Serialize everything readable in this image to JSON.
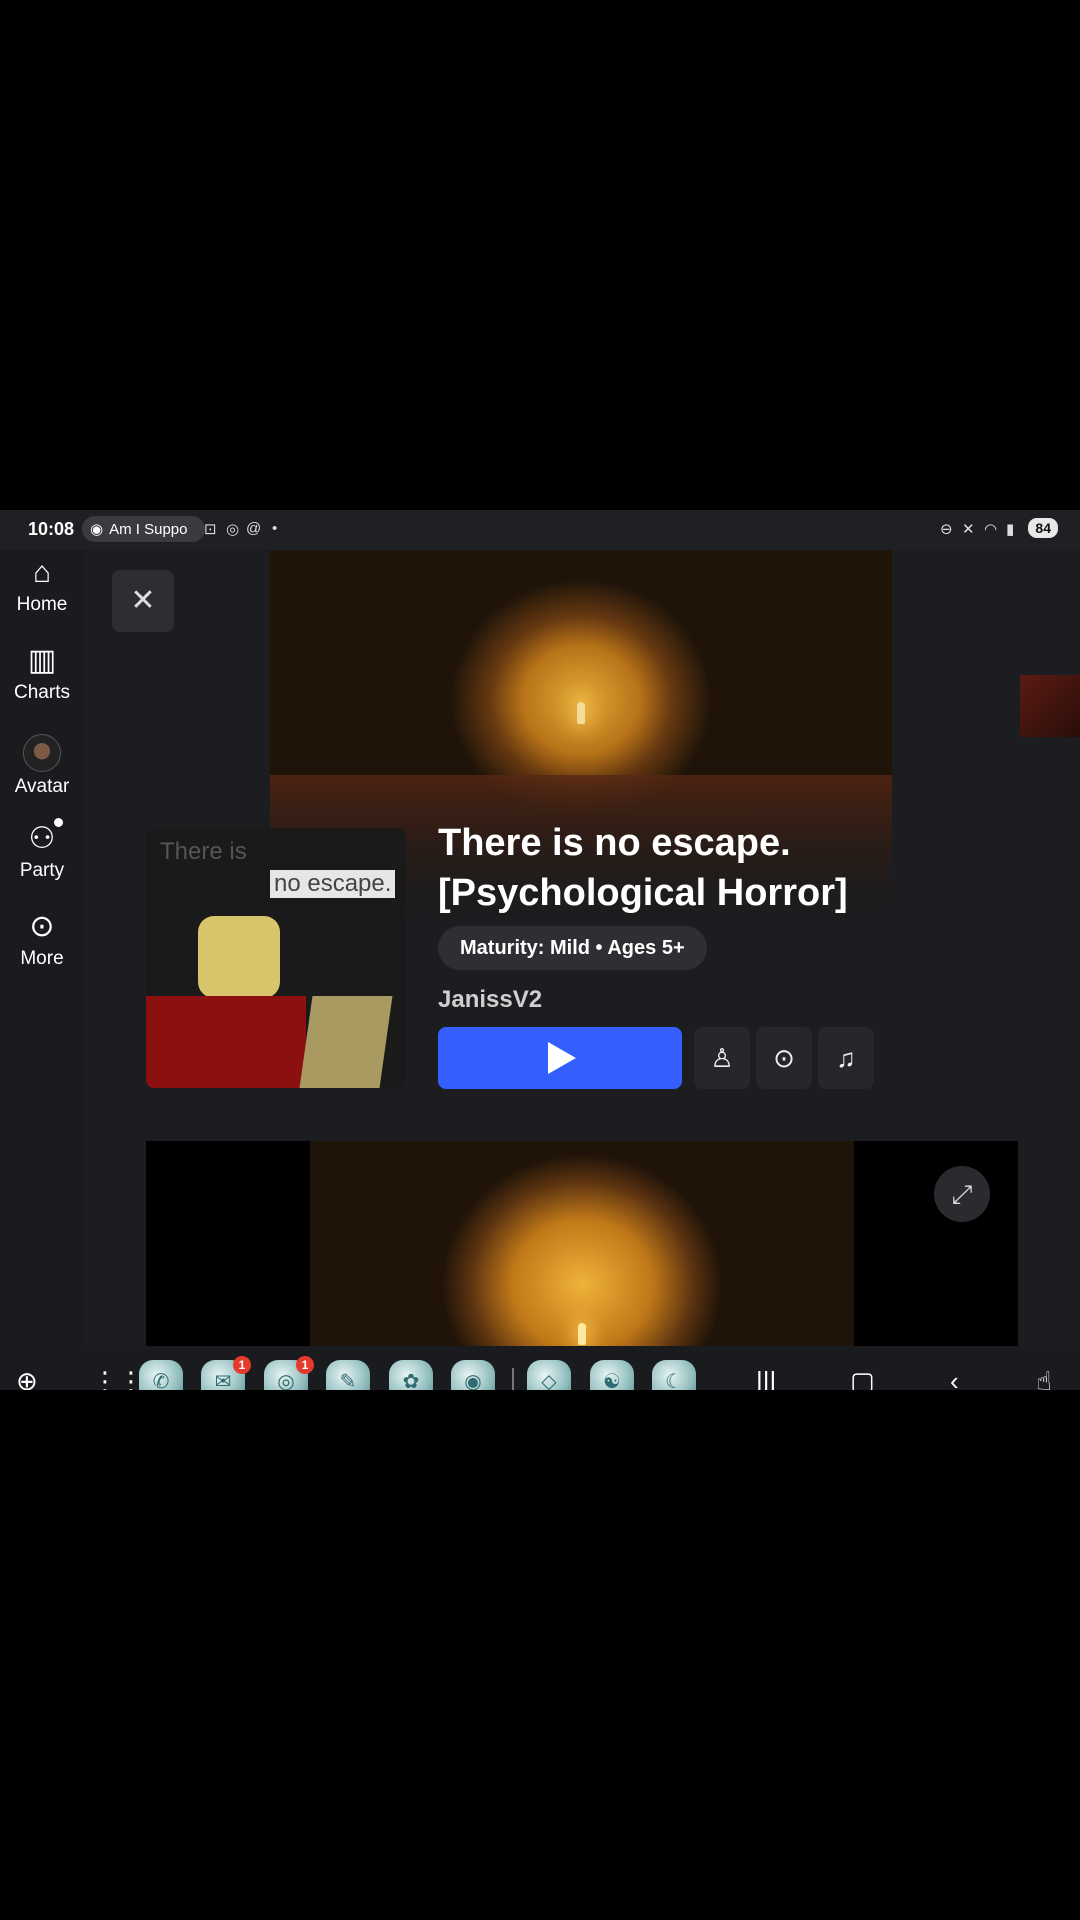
{
  "status_bar": {
    "time": "10:08",
    "media_text": "Am I Suppo",
    "battery": "84"
  },
  "sidebar": {
    "items": [
      {
        "label": "Home",
        "icon": "home-icon"
      },
      {
        "label": "Charts",
        "icon": "charts-icon"
      },
      {
        "label": "Avatar",
        "icon": "avatar-icon"
      },
      {
        "label": "Party",
        "icon": "party-icon"
      },
      {
        "label": "More",
        "icon": "more-icon"
      }
    ]
  },
  "thumbnail": {
    "line1": "There is",
    "line2": "no escape."
  },
  "game": {
    "title_line1": "There is no escape.",
    "title_line2": "[Psychological Horror]",
    "maturity": "Maturity: Mild • Ages 5+",
    "creator": "JanissV2"
  },
  "actions": {
    "play_icon": "play-icon",
    "buttons": [
      "invite-play-icon",
      "more-options-icon",
      "notification-bell-icon"
    ]
  },
  "taskbar": {
    "badges": {
      "messages": "1",
      "chrome": "1"
    }
  },
  "colors": {
    "play_button": "#335fff",
    "background": "#1c1d20",
    "badge": "#e53b2c"
  }
}
